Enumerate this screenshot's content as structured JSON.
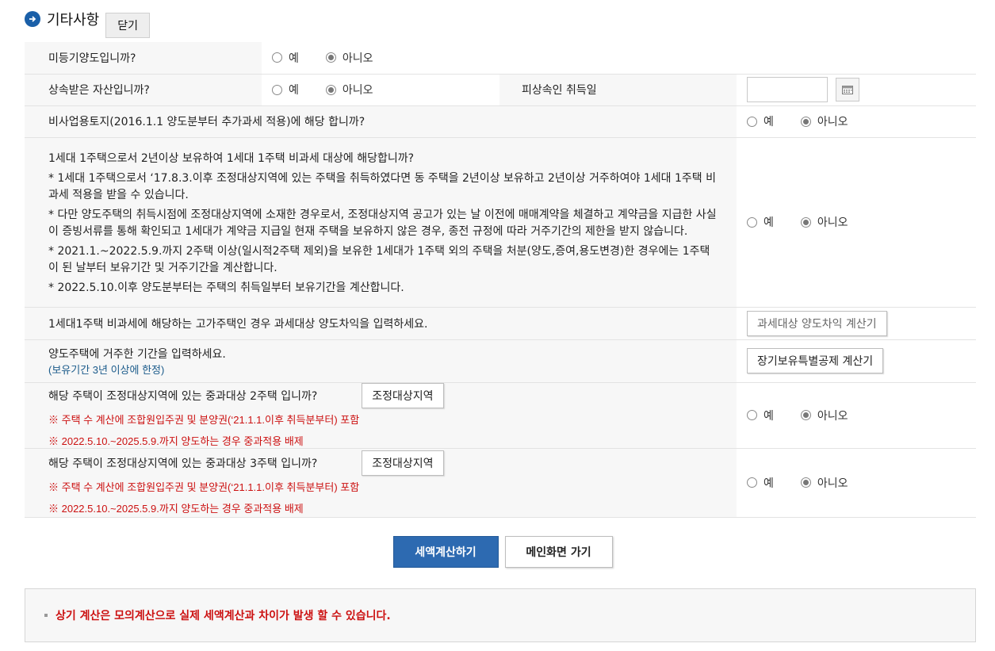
{
  "section": {
    "title": "기타사항",
    "close_label": "닫기"
  },
  "options": {
    "yes": "예",
    "no": "아니오"
  },
  "rows": {
    "unregistered": {
      "question": "미등기양도입니까?"
    },
    "inherited": {
      "question": "상속받은 자산입니까?",
      "decedent_label": "피상속인 취득일"
    },
    "nonbusiness": {
      "question": "비사업용토지(2016.1.1 양도분부터 추가과세 적용)에 해당 합니까?"
    },
    "one_house": {
      "question": "1세대 1주택으로서 2년이상 보유하여 1세대 1주택 비과세 대상에 해당합니까?",
      "notes": [
        "* 1세대 1주택으로서 ‘17.8.3.이후 조정대상지역에 있는 주택을 취득하였다면 동 주택을 2년이상 보유하고 2년이상 거주하여야 1세대 1주택 비과세 적용을 받을 수 있습니다.",
        "* 다만 양도주택의 취득시점에 조정대상지역에 소재한 경우로서, 조정대상지역 공고가 있는 날 이전에 매매계약을 체결하고 계약금을 지급한 사실이 증빙서류를 통해 확인되고 1세대가 계약금 지급일 현재 주택을 보유하지 않은 경우, 종전 규정에 따라 거주기간의 제한을 받지 않습니다.",
        "* 2021.1.~2022.5.9.까지 2주택 이상(일시적2주택 제외)을 보유한 1세대가 1주택 외의 주택을 처분(양도,증여,용도변경)한 경우에는 1주택이 된 날부터 보유기간 및 거주기간을 계산합니다.",
        "* 2022.5.10.이후 양도분부터는 주택의 취득일부터 보유기간을 계산합니다."
      ]
    },
    "luxury": {
      "question": "1세대1주택 비과세에 해당하는 고가주택인 경우 과세대상 양도차익을 입력하세요.",
      "button": "과세대상 양도차익 계산기"
    },
    "residence": {
      "question": "양도주택에 거주한 기간을 입력하세요.",
      "sub": "(보유기간 3년 이상에 한정)",
      "button": "장기보유특별공제 계산기"
    },
    "heavy2": {
      "question": "해당 주택이 조정대상지역에 있는 중과대상 2주택 입니까?",
      "button": "조정대상지역",
      "note1": "※ 주택 수 계산에 조합원입주권 및 분양권(‘21.1.1.이후 취득분부터) 포함",
      "note2": "※ 2022.5.10.~2025.5.9.까지 양도하는 경우 중과적용 배제"
    },
    "heavy3": {
      "question": "해당 주택이 조정대상지역에 있는 중과대상 3주택 입니까?",
      "button": "조정대상지역",
      "note1": "※ 주택 수 계산에 조합원입주권 및 분양권(‘21.1.1.이후 취득분부터) 포함",
      "note2": "※ 2022.5.10.~2025.5.9.까지 양도하는 경우 중과적용 배제"
    }
  },
  "actions": {
    "calculate": "세액계산하기",
    "main": "메인화면 가기"
  },
  "notice": "상기 계산은 모의계산으로 실제 세액계산과 차이가 발생 할 수 있습니다.",
  "colors": {
    "primary": "#2d6ab1",
    "alert": "#cc1111",
    "sub_note": "#1a5a8a",
    "icon": "#1a5fa8"
  }
}
